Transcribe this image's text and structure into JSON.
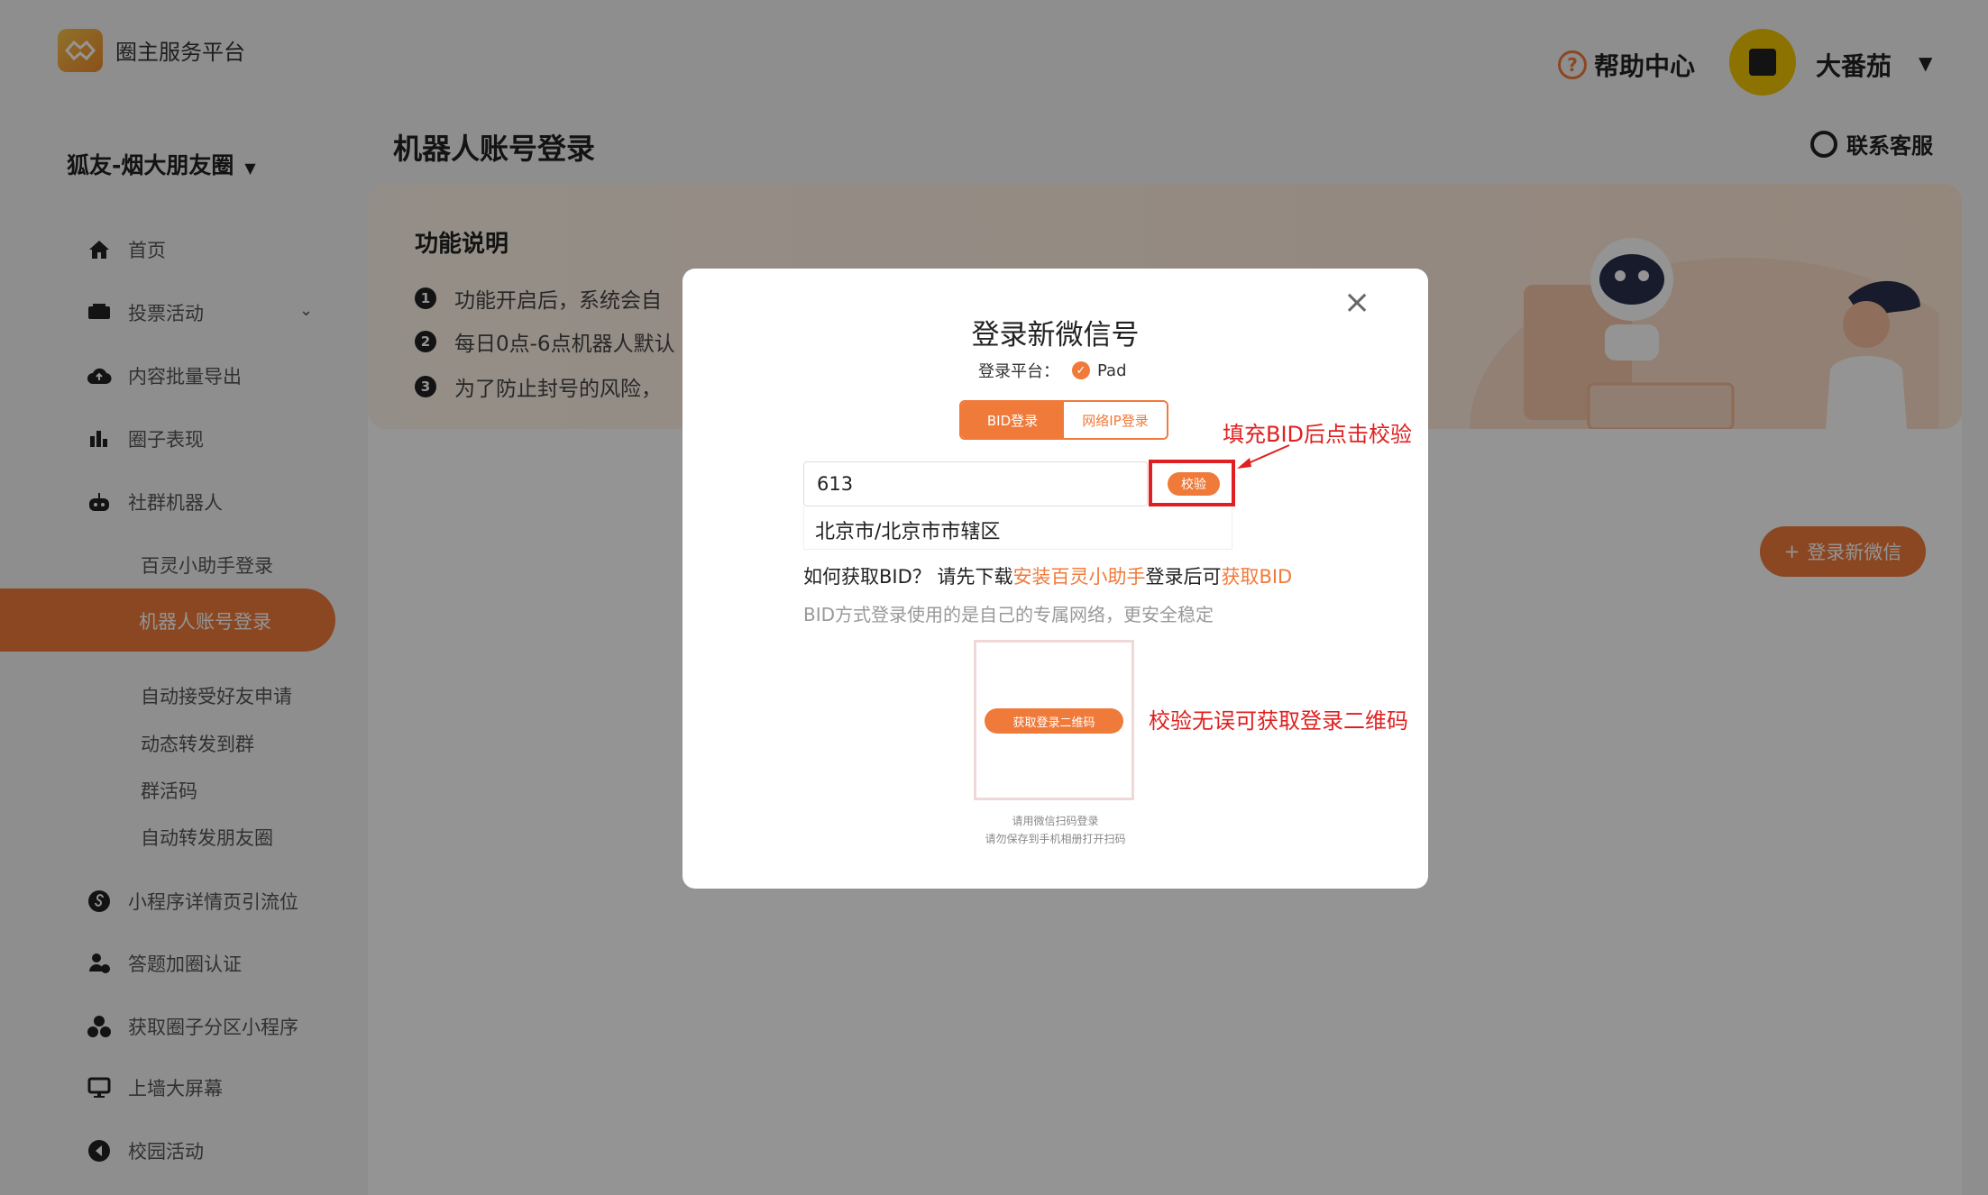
{
  "app": {
    "brand": "圈主服务平台"
  },
  "header": {
    "help_label": "帮助中心",
    "help_icon": "question-circle-icon",
    "username": "大番茄",
    "caret": "▼"
  },
  "sidebar": {
    "circle_name": "狐友-烟大朋友圈",
    "circle_caret": "▼",
    "items": [
      {
        "label": "首页",
        "icon": "home-icon"
      },
      {
        "label": "投票活动",
        "icon": "vote-icon"
      },
      {
        "label": "内容批量导出",
        "icon": "cloud-upload-icon"
      },
      {
        "label": "圈子表现",
        "icon": "bar-chart-icon"
      },
      {
        "label": "社群机器人",
        "icon": "robot-icon"
      },
      {
        "label": "小程序详情页引流位",
        "icon": "miniprogram-icon"
      },
      {
        "label": "答题加圈认证",
        "icon": "user-check-icon"
      },
      {
        "label": "获取圈子分区小程序",
        "icon": "apps-icon"
      },
      {
        "label": "上墙大屏幕",
        "icon": "screen-icon"
      },
      {
        "label": "校园活动",
        "icon": "campus-icon"
      }
    ],
    "sub_items": [
      "百灵小助手登录",
      "机器人账号登录",
      "自动接受好友申请",
      "动态转发到群",
      "群活码",
      "自动转发朋友圈"
    ],
    "active_sub": "机器人账号登录"
  },
  "main": {
    "title": "机器人账号登录",
    "contact_label": "联系客服",
    "info_title": "功能说明",
    "info_lines": [
      "功能开启后，系统会自",
      "每日0点-6点机器人默认",
      "为了防止封号的风险，"
    ],
    "login_button": "登录新微信"
  },
  "modal": {
    "close": "×",
    "title": "登录新微信号",
    "platform_label": "登录平台：",
    "platform_value": "Pad",
    "tabs": [
      "BID登录",
      "网络IP登录"
    ],
    "bid_value": "613",
    "verify_label": "校验",
    "location": "北京市/北京市市辖区",
    "how_prefix": "如何获取BID？ 请先下载",
    "how_link1": "安装百灵小助手",
    "how_mid": "登录后可",
    "how_link2": "获取BID",
    "note": "BID方式登录使用的是自己的专属网络，更安全稳定",
    "qr_button": "获取登录二维码",
    "scan_line1": "请用微信扫码登录",
    "scan_line2": "请勿保存到手机相册打开扫码"
  },
  "annotations": {
    "verify_hint": "填充BID后点击校验",
    "qr_hint": "校验无误可获取登录二维码"
  },
  "colors": {
    "accent": "#f07a3a",
    "annotation": "#e02020"
  }
}
